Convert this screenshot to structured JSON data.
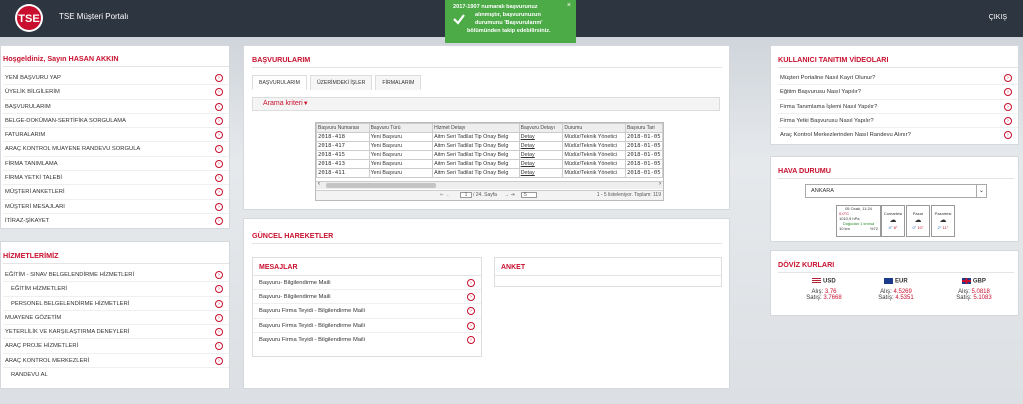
{
  "header": {
    "portal_title": "TSE Müşteri Portalı",
    "logo_text": "TSE",
    "exit_label": "ÇIKIŞ"
  },
  "toast": {
    "line1": "2017-1907  numaralı başvurunuz",
    "line2": "alınmıştır, başvurunuzun",
    "line3": "durumunu 'Başvurularım'",
    "line4": "bölümünden takip edebilirsiniz.",
    "close": "×"
  },
  "sidebar": {
    "welcome": "Hoşgeldiniz, Sayın HASAN AKKIN",
    "items": [
      "YENİ BAŞVURU YAP",
      "ÜYELİK BİLGİLERİM",
      "BAŞVURULARIM",
      "BELGE-DOKÜMAN-SERTİFİKA SORGULAMA",
      "FATURALARIM",
      "ARAÇ KONTROL MUAYENE RANDEVU SORGULA",
      "FİRMA TANIMLAMA",
      "FİRMA YETKİ TALEBİ",
      "MÜŞTERİ ANKETLERİ",
      "MÜŞTERİ MESAJLARI",
      "İTİRAZ-ŞİKAYET"
    ],
    "services_title": "HİZMETLERİMİZ",
    "services": [
      "EĞİTİM - SINAV BELGELENDİRME HİZMETLERİ",
      "EĞİTİM HİZMETLERİ",
      "PERSONEL BELGELENDİRME HİZMETLERİ",
      "MUAYENE GÖZETİM",
      "YETERLİLİK VE KARŞILAŞTIRMA DENEYLERİ",
      "ARAÇ PROJE HİZMETLERİ",
      "ARAÇ KONTROL MERKEZLERİ",
      "RANDEVU AL"
    ]
  },
  "basvurular": {
    "title": "BAŞVURULARIM",
    "tabs": [
      "BAŞVURULARIM",
      "ÜZERİMDEKİ İŞLER",
      "FİRMALARIM"
    ],
    "search_label": "Arama kriteri",
    "columns": [
      "Başvuru Numarası",
      "Başvuru Türü",
      "Hizmet Detayı",
      "Başvuru Detayı",
      "Durumu",
      "Başvuru Tari"
    ],
    "rows": [
      [
        "2018-418",
        "Yeni Başvuru",
        "Aitm Seri Tadilat Tip Onay Belg",
        "Detay",
        "Müdür/Teknik Yönetici",
        "2018-01-05"
      ],
      [
        "2018-417",
        "Yeni Başvuru",
        "Aitm Seri Tadilat Tip Onay Belg",
        "Detay",
        "Müdür/Teknik Yönetici",
        "2018-01-05"
      ],
      [
        "2018-415",
        "Yeni Başvuru",
        "Aitm Seri Tadilat Tip Onay Belg",
        "Detay",
        "Müdür/Teknik Yönetici",
        "2018-01-05"
      ],
      [
        "2018-413",
        "Yeni Başvuru",
        "Aitm Seri Tadilat Tip Onay Belg",
        "Detay",
        "Müdür/Teknik Yönetici",
        "2018-01-05"
      ],
      [
        "2018-411",
        "Yeni Başvuru",
        "Aitm Seri Tadilat Tip Onay Belg",
        "Detay",
        "Müdür/Teknik Yönetici",
        "2018-01-05"
      ]
    ],
    "pager_page": "1",
    "pager_total": "/ 24. Sayfa",
    "pager_size": "5",
    "pager_status": "1 - 5 listeleniyor. Toplam: 119"
  },
  "guncel": {
    "title": "GÜNCEL HAREKETLER",
    "messages_title": "MESAJLAR",
    "messages": [
      "Başvuru- Bilgilendirme Maili",
      "Başvuru- Bilgilendirme Maili",
      "Başvuru Firma Teyidi - Bilgilendirme Maili",
      "Başvuru Firma Teyidi - Bilgilendirme Maili",
      "Başvuru Firma Teyidi - Bilgilendirme Maili"
    ],
    "survey_title": "ANKET"
  },
  "videos": {
    "title": "KULLANICI TANITIM VİDEOLARI",
    "items": [
      "Müşteri Portaline Nasıl Kayıt Olunur?",
      "Eğitim Başvurusu Nasıl Yapılır?",
      "Firma Tanımlama İşlemi Nasıl Yapılır?",
      "Firma Yetki Başvurusu Nasıl Yapılır?",
      "Araç Kontrol Merkezlerinden Nasıl Randevu Alınır?"
    ]
  },
  "weather": {
    "title": "HAVA DURUMU",
    "city": "ANKARA",
    "today": {
      "date": "05 Ocak, 11:24",
      "temp": "0,0°C",
      "pressure": "1010,9 hPa",
      "wind": "Doğudan 1 km/sa",
      "visibility": "10 km",
      "humidity": "%72"
    },
    "forecast": [
      {
        "day": "Cumartesi",
        "low": "0°",
        "high": "8°"
      },
      {
        "day": "Pazar",
        "low": "0°",
        "high": "10°"
      },
      {
        "day": "Pazartesi",
        "low": "2°",
        "high": "11°"
      }
    ]
  },
  "doviz": {
    "title": "DÖVİZ KURLARI",
    "buy_label": "Alış",
    "sell_label": "Satış",
    "items": [
      {
        "code": "USD",
        "buy": "3.76",
        "sell": "3.7668"
      },
      {
        "code": "EUR",
        "buy": "4.5269",
        "sell": "4.5351"
      },
      {
        "code": "GBP",
        "buy": "5.0818",
        "sell": "5.1083"
      }
    ]
  },
  "colors": {
    "brand_red": "#c8102e",
    "header_bg": "#2d3540",
    "toast_green": "#4caa47"
  }
}
